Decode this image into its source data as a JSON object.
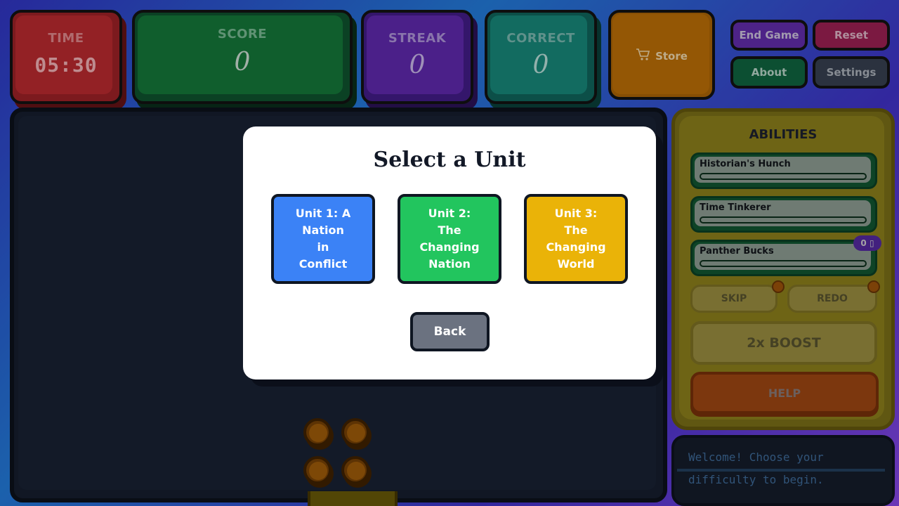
{
  "stats": {
    "time": {
      "label": "TIME",
      "value": "05:30"
    },
    "score": {
      "label": "SCORE",
      "value": "0"
    },
    "streak": {
      "label": "STREAK",
      "value": "0"
    },
    "correct": {
      "label": "CORRECT",
      "value": "0"
    }
  },
  "store": {
    "label": "Store",
    "icon": "cart-icon"
  },
  "controls": {
    "end_game": "End Game",
    "reset": "Reset",
    "about": "About",
    "settings": "Settings"
  },
  "abilities": {
    "title": "ABILITIES",
    "items": [
      {
        "label": "Historian's Hunch",
        "progress": 0
      },
      {
        "label": "Time Tinkerer",
        "progress": 0
      },
      {
        "label": "Panther Bucks",
        "progress": 0
      }
    ],
    "bucks_badge": "0 ▯",
    "skip": "SKIP",
    "redo": "REDO",
    "boost": "2x BOOST",
    "help": "HELP"
  },
  "message": {
    "text": "Welcome! Choose your difficulty to begin."
  },
  "modal": {
    "title": "Select a Unit",
    "units": [
      {
        "label": "Unit 1: A\nNation\nin\nConflict",
        "color": "#3b82f6"
      },
      {
        "label": "Unit 2:\nThe\nChanging\nNation",
        "color": "#22c55e"
      },
      {
        "label": "Unit 3:\nThe\nChanging\nWorld",
        "color": "#eab308"
      }
    ],
    "back": "Back"
  }
}
